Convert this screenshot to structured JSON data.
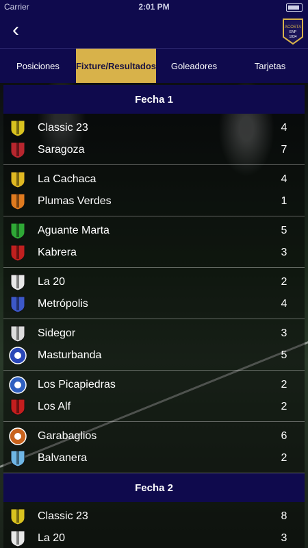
{
  "status": {
    "carrier": "Carrier",
    "time": "2:01 PM"
  },
  "header": {
    "crest_text": [
      "ACOSTA",
      "ENP",
      "1834"
    ]
  },
  "tabs": [
    {
      "label": "Posiciones",
      "active": false
    },
    {
      "label": "Fixture/Resultados",
      "active": true
    },
    {
      "label": "Goleadores",
      "active": false
    },
    {
      "label": "Tarjetas",
      "active": false
    }
  ],
  "rounds": [
    {
      "title": "Fecha 1",
      "matches": [
        {
          "home": {
            "name": "Classic 23",
            "score": "4",
            "icon": "shield-yellow-black",
            "color": "#d9c21f"
          },
          "away": {
            "name": "Saragoza",
            "score": "7",
            "icon": "shield-red-green",
            "color": "#b8262e"
          }
        },
        {
          "home": {
            "name": "La Cachaca",
            "score": "4",
            "icon": "shield-yellow-black",
            "color": "#e0b822"
          },
          "away": {
            "name": "Plumas Verdes",
            "score": "1",
            "icon": "shield-orange-green",
            "color": "#e07b1f"
          }
        },
        {
          "home": {
            "name": "Aguante Marta",
            "score": "5",
            "icon": "shield-green",
            "color": "#2fa836"
          },
          "away": {
            "name": "Kabrera",
            "score": "3",
            "icon": "shield-red-star",
            "color": "#c0201f"
          }
        },
        {
          "home": {
            "name": "La 20",
            "score": "2",
            "icon": "shield-white-black",
            "color": "#e8e8e8"
          },
          "away": {
            "name": "Metrópolis",
            "score": "4",
            "icon": "shield-blue-white",
            "color": "#3c58c8"
          }
        },
        {
          "home": {
            "name": "Sidegor",
            "score": "3",
            "icon": "shield-white-black",
            "color": "#dcdcdc"
          },
          "away": {
            "name": "Masturbanda",
            "score": "5",
            "icon": "badge-blue",
            "color": "#2a47b8"
          }
        },
        {
          "home": {
            "name": "Los Picapiedras",
            "score": "2",
            "icon": "badge-blue-orange",
            "color": "#2f5fc0"
          },
          "away": {
            "name": "Los Alf",
            "score": "2",
            "icon": "shield-red-black",
            "color": "#c41e1e"
          }
        },
        {
          "home": {
            "name": "Garabaglios",
            "score": "6",
            "icon": "badge-orange",
            "color": "#c9631d"
          },
          "away": {
            "name": "Balvanera",
            "score": "2",
            "icon": "shield-lightblue",
            "color": "#6fb6e6"
          }
        }
      ]
    },
    {
      "title": "Fecha 2",
      "matches": [
        {
          "home": {
            "name": "Classic 23",
            "score": "8",
            "icon": "shield-yellow-black",
            "color": "#d9c21f"
          },
          "away": {
            "name": "La 20",
            "score": "3",
            "icon": "shield-white-black",
            "color": "#e8e8e8"
          }
        }
      ]
    }
  ]
}
